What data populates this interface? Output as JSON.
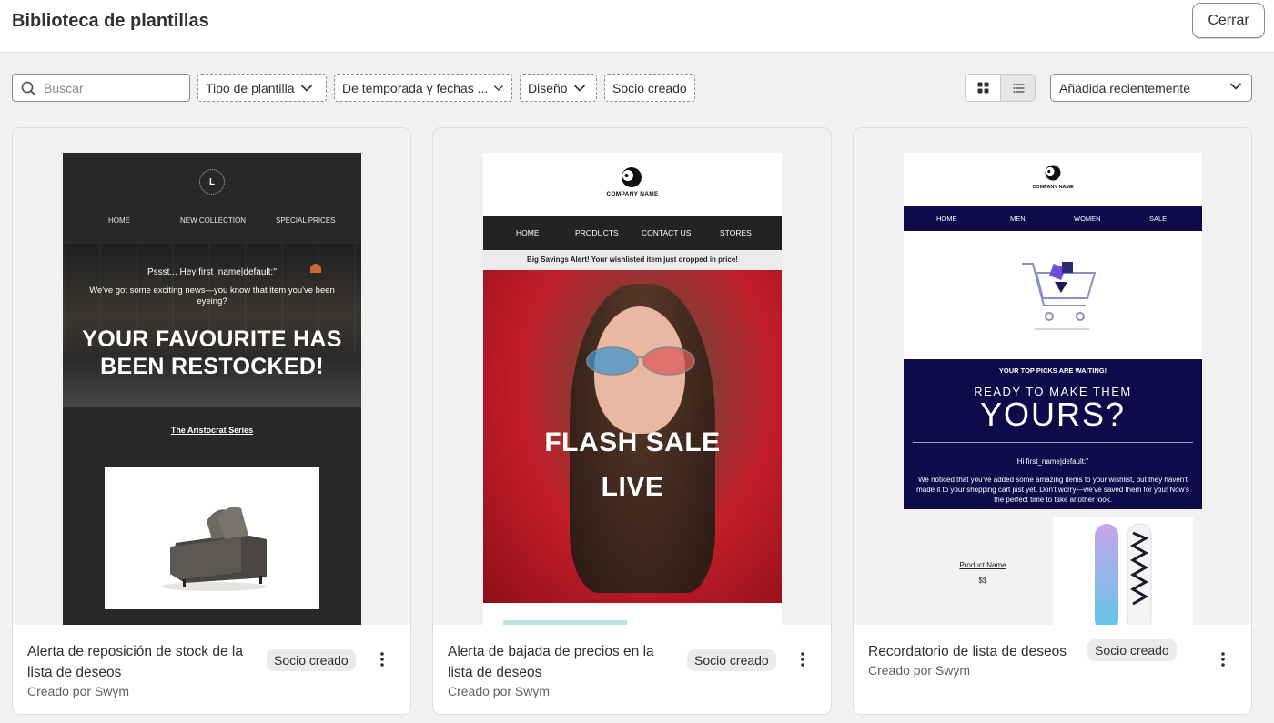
{
  "header": {
    "title": "Biblioteca de plantillas",
    "close_label": "Cerrar"
  },
  "toolbar": {
    "search_placeholder": "Buscar",
    "filters": [
      {
        "label": "Tipo de plantilla"
      },
      {
        "label": "De temporada y fechas ..."
      },
      {
        "label": "Diseño"
      },
      {
        "label": "Socio creado"
      }
    ],
    "sort_label": "Añadida recientemente",
    "view": "grid"
  },
  "cards": [
    {
      "name": "Alerta de reposición de stock de la lista de deseos",
      "badge": "Socio creado",
      "creator": "Creado por Swym",
      "email": {
        "logo_letter": "L",
        "nav": [
          "HOME",
          "NEW COLLECTION",
          "SPECIAL PRICES"
        ],
        "line1": "Pssst... Hey first_name|default:''",
        "line2": "We've got some exciting news—you know that item you've been eyeing?",
        "headline": "YOUR FAVOURITE HAS BEEN RESTOCKED!",
        "series": "The Aristocrat Series"
      }
    },
    {
      "name": "Alerta de bajada de precios en la lista de deseos",
      "badge": "Socio creado",
      "creator": "Creado por Swym",
      "email": {
        "company": "COMPANY NAME",
        "nav": [
          "HOME",
          "PRODUCTS",
          "CONTACT US",
          "STORES"
        ],
        "alert": "Big Savings Alert! Your wishlisted item just dropped in price!",
        "headline_1": "FLASH SALE",
        "headline_2": "LIVE"
      }
    },
    {
      "name": "Recordatorio de lista de deseos",
      "badge": "Socio creado",
      "creator": "Creado por Swym",
      "email": {
        "company": "COMPANY NAME",
        "nav": [
          "HOME",
          "MEN",
          "WOMEN",
          "SALE"
        ],
        "kicker": "YOUR TOP PICKS ARE WAITING!",
        "sub": "READY TO MAKE THEM",
        "headline": "YOURS?",
        "greeting": "Hi first_name|default:''",
        "body": "We noticed that you've added some amazing items to your wishlist, but they haven't made it to your shopping cart just yet. Don't worry—we've saved them for you! Now's the perfect time to take another look.",
        "product_name": "Product Name",
        "price": "$$"
      }
    }
  ],
  "colors": {
    "card_border": "#dcdcdc",
    "email3_navy": "#0d0b4a",
    "email1_dark": "#282828",
    "email2_red": "#c21d2a"
  }
}
